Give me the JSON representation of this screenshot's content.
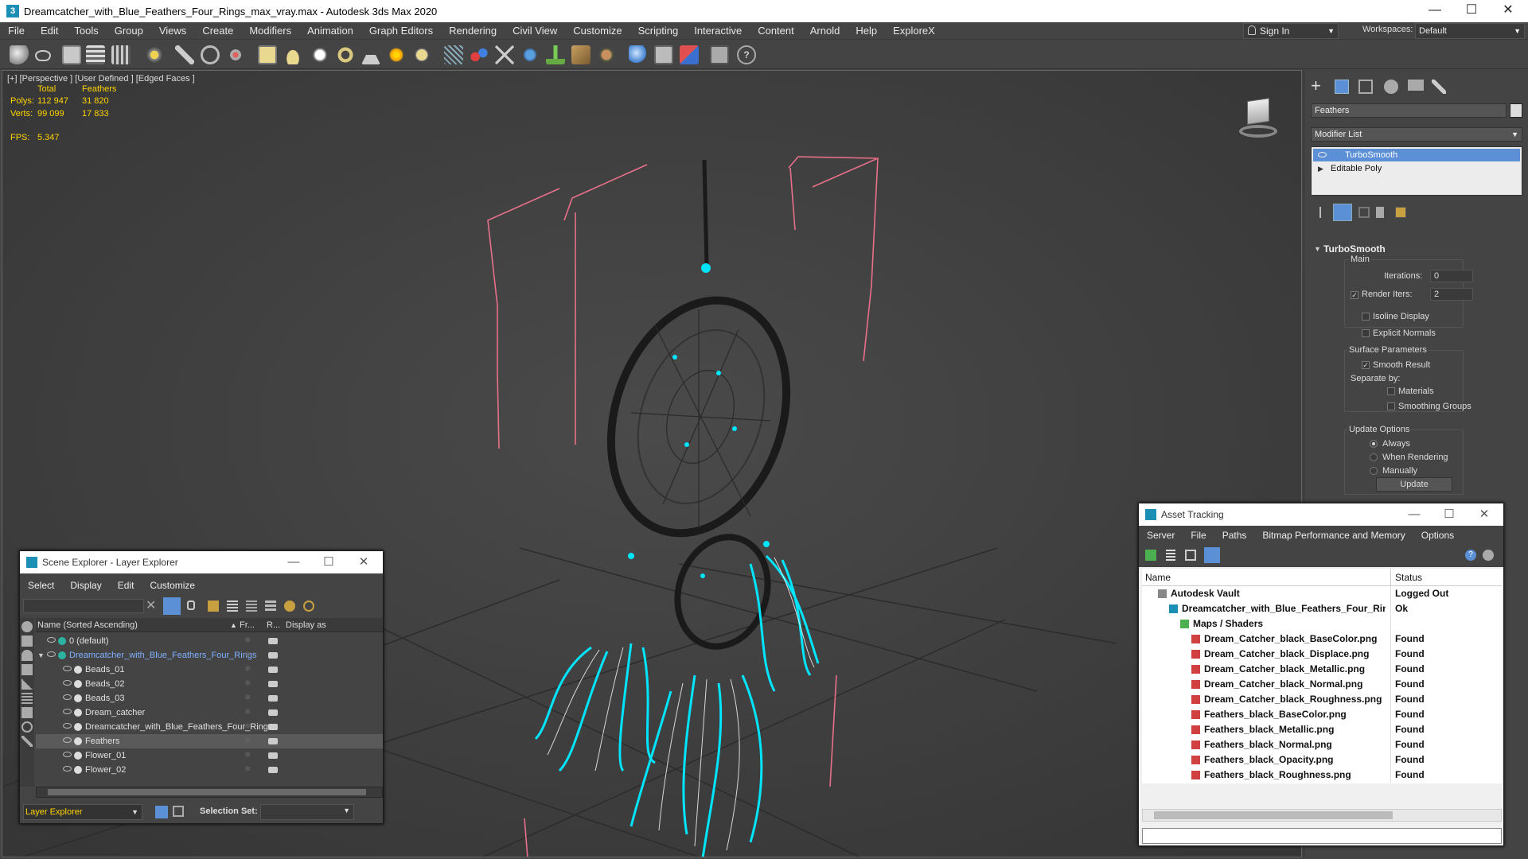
{
  "window": {
    "title": "Dreamcatcher_with_Blue_Feathers_Four_Rings_max_vray.max - Autodesk 3ds Max 2020",
    "minimize_glyph": "—",
    "maximize_glyph": "☐",
    "close_glyph": "✕"
  },
  "menu": [
    "File",
    "Edit",
    "Tools",
    "Group",
    "Views",
    "Create",
    "Modifiers",
    "Animation",
    "Graph Editors",
    "Rendering",
    "Civil View",
    "Customize",
    "Scripting",
    "Interactive",
    "Content",
    "Arnold",
    "Help",
    "ExploreX"
  ],
  "account": {
    "signin_label": "Sign In",
    "workspaces_label": "Workspaces:",
    "workspace_value": "Default"
  },
  "viewport": {
    "label": "[+] [Perspective ] [User Defined ] [Edged Faces ]",
    "stats": {
      "col_total": "Total",
      "col_selected": "Feathers",
      "polys_label": "Polys:",
      "polys_total": "112 947",
      "polys_selected": "31 820",
      "verts_label": "Verts:",
      "verts_total": "99 099",
      "verts_selected": "17 833",
      "fps_label": "FPS:",
      "fps_value": "5.347"
    }
  },
  "command_panel": {
    "object_name": "Feathers",
    "modifier_list_label": "Modifier List",
    "stack": [
      {
        "label": "TurboSmooth",
        "selected": true
      },
      {
        "label": "Editable Poly",
        "selected": false
      }
    ],
    "rollout_title": "TurboSmooth",
    "main_label": "Main",
    "iterations_label": "Iterations:",
    "iterations_value": "0",
    "render_iters_label": "Render Iters:",
    "render_iters_value": "2",
    "isoline_label": "Isoline Display",
    "explicit_normals_label": "Explicit Normals",
    "surface_params_label": "Surface Parameters",
    "smooth_result_label": "Smooth Result",
    "separate_by_label": "Separate by:",
    "materials_label": "Materials",
    "smoothing_groups_label": "Smoothing Groups",
    "update_options_label": "Update Options",
    "always_label": "Always",
    "when_rendering_label": "When Rendering",
    "manually_label": "Manually",
    "update_button": "Update"
  },
  "scene_explorer": {
    "title": "Scene Explorer - Layer Explorer",
    "menu": [
      "Select",
      "Display",
      "Edit",
      "Customize"
    ],
    "col_name": "Name (Sorted Ascending)",
    "col_fr": "Fr...",
    "col_r": "R...",
    "col_display": "Display as",
    "rows": [
      {
        "label": "0 (default)",
        "indent": 0,
        "type": "layer"
      },
      {
        "label": "Dreamcatcher_with_Blue_Feathers_Four_Rings",
        "indent": 0,
        "type": "layer-active"
      },
      {
        "label": "Beads_01",
        "indent": 1,
        "type": "obj"
      },
      {
        "label": "Beads_02",
        "indent": 1,
        "type": "obj"
      },
      {
        "label": "Beads_03",
        "indent": 1,
        "type": "obj"
      },
      {
        "label": "Dream_catcher",
        "indent": 1,
        "type": "obj"
      },
      {
        "label": "Dreamcatcher_with_Blue_Feathers_Four_Rings",
        "indent": 1,
        "type": "group"
      },
      {
        "label": "Feathers",
        "indent": 1,
        "type": "obj-selected"
      },
      {
        "label": "Flower_01",
        "indent": 1,
        "type": "obj"
      },
      {
        "label": "Flower_02",
        "indent": 1,
        "type": "obj"
      }
    ],
    "footer_explorer": "Layer Explorer",
    "footer_selset_label": "Selection Set:"
  },
  "asset_tracking": {
    "title": "Asset Tracking",
    "menu": [
      "Server",
      "File",
      "Paths",
      "Bitmap Performance and Memory",
      "Options"
    ],
    "col_name": "Name",
    "col_status": "Status",
    "rows": [
      {
        "name": "Autodesk Vault",
        "status": "Logged Out",
        "indent": 0,
        "type": "vault"
      },
      {
        "name": "Dreamcatcher_with_Blue_Feathers_Four_Rings_max_vray.max",
        "status": "Ok",
        "indent": 1,
        "type": "max"
      },
      {
        "name": "Maps / Shaders",
        "status": "",
        "indent": 2,
        "type": "folder"
      },
      {
        "name": "Dream_Catcher_black_BaseColor.png",
        "status": "Found",
        "indent": 3,
        "type": "png"
      },
      {
        "name": "Dream_Catcher_black_Displace.png",
        "status": "Found",
        "indent": 3,
        "type": "png"
      },
      {
        "name": "Dream_Catcher_black_Metallic.png",
        "status": "Found",
        "indent": 3,
        "type": "png"
      },
      {
        "name": "Dream_Catcher_black_Normal.png",
        "status": "Found",
        "indent": 3,
        "type": "png"
      },
      {
        "name": "Dream_Catcher_black_Roughness.png",
        "status": "Found",
        "indent": 3,
        "type": "png"
      },
      {
        "name": "Feathers_black_BaseColor.png",
        "status": "Found",
        "indent": 3,
        "type": "png"
      },
      {
        "name": "Feathers_black_Metallic.png",
        "status": "Found",
        "indent": 3,
        "type": "png"
      },
      {
        "name": "Feathers_black_Normal.png",
        "status": "Found",
        "indent": 3,
        "type": "png"
      },
      {
        "name": "Feathers_black_Opacity.png",
        "status": "Found",
        "indent": 3,
        "type": "png"
      },
      {
        "name": "Feathers_black_Roughness.png",
        "status": "Found",
        "indent": 3,
        "type": "png"
      }
    ]
  },
  "colors": {
    "selection_cyan": "#00e5ff",
    "bbox_pink": "#e8708a",
    "stats_yellow": "#ffd400",
    "highlight_blue": "#5b8fd6"
  }
}
